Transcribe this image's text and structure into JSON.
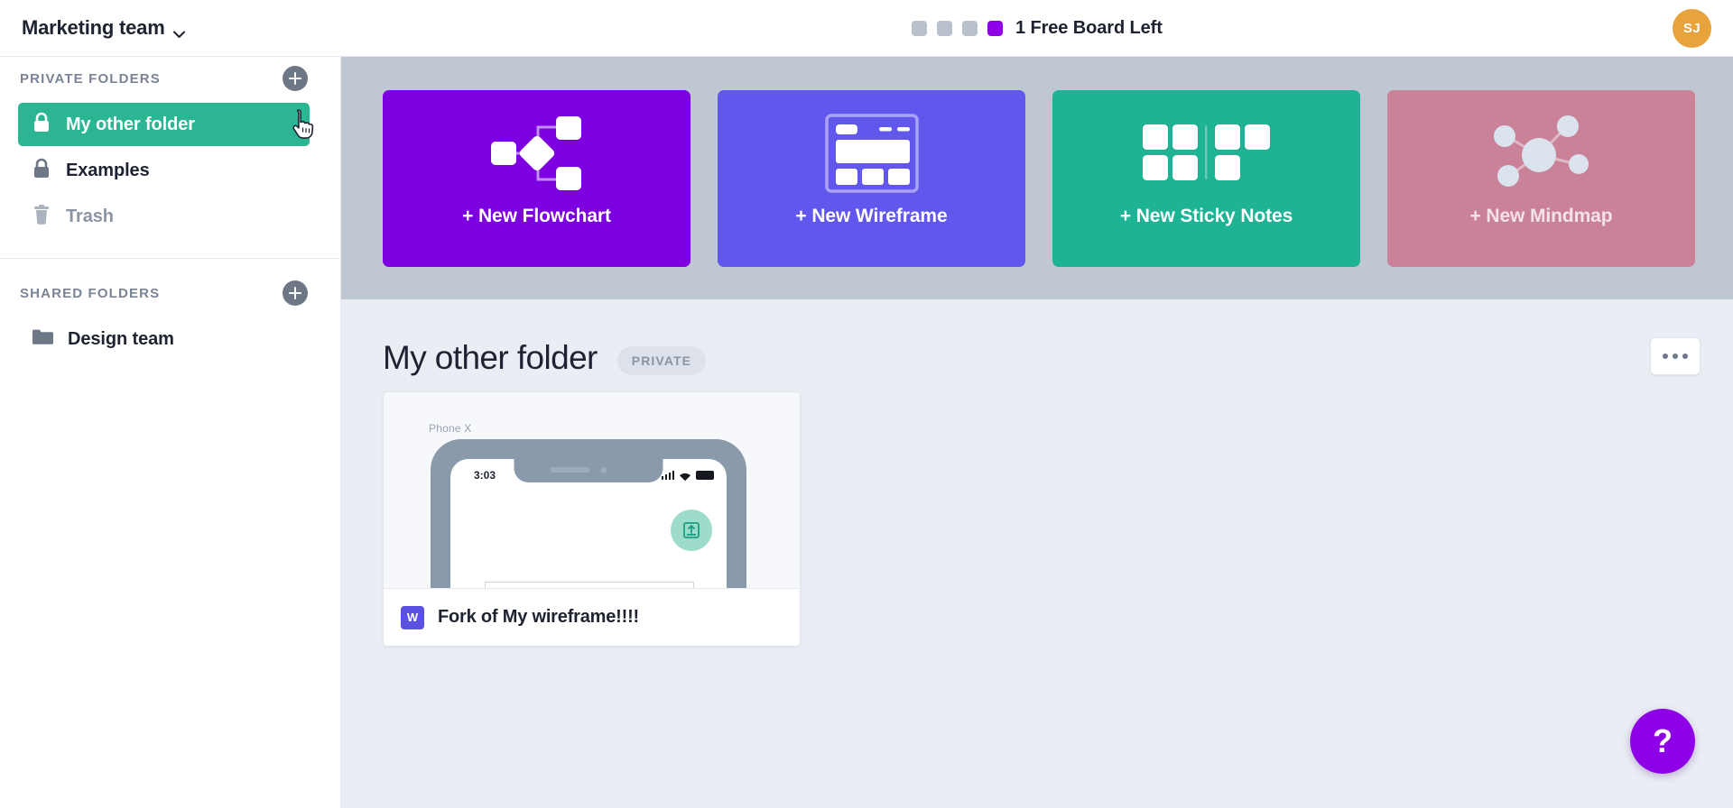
{
  "topbar": {
    "team_name": "Marketing team",
    "team_chevron_icon": "chevron-down-icon",
    "quota_label": "1 Free Board Left",
    "quota_total": 4,
    "quota_used": 1,
    "quota_used_color": "#8e00e6",
    "quota_empty_color": "#b9c1cc",
    "avatar_initials": "SJ",
    "avatar_color": "#e8a33d"
  },
  "sidebar": {
    "private": {
      "title": "PRIVATE FOLDERS",
      "add_icon": "plus-icon",
      "items": [
        {
          "label": "My other folder",
          "icon": "lock-icon",
          "active": true
        },
        {
          "label": "Examples",
          "icon": "lock-icon",
          "active": false
        },
        {
          "label": "Trash",
          "icon": "trash-icon",
          "active": false
        }
      ]
    },
    "shared": {
      "title": "SHARED FOLDERS",
      "add_icon": "plus-icon",
      "items": [
        {
          "label": "Design team",
          "icon": "folder-icon",
          "active": false
        }
      ]
    },
    "active_color": "#2cb593"
  },
  "create_cards": [
    {
      "label": "+ New Flowchart",
      "icon": "flowchart-icon",
      "color": "#7d00e0"
    },
    {
      "label": "+ New Wireframe",
      "icon": "wireframe-icon",
      "color": "#6257ec"
    },
    {
      "label": "+ New Sticky Notes",
      "icon": "sticky-notes-icon",
      "color": "#1db394"
    },
    {
      "label": "+ New Mindmap",
      "icon": "mindmap-icon",
      "color": "#c98298"
    }
  ],
  "folder": {
    "title": "My other folder",
    "badge": "PRIVATE",
    "more_icon": "ellipsis-icon"
  },
  "boards": [
    {
      "name": "Fork of My wireframe!!!!",
      "type_badge": "W",
      "type_badge_color": "#5a50e2",
      "thumb_caption": "Phone X",
      "thumb_time": "3:03",
      "thumb_icons": [
        "signal-icon",
        "wifi-icon",
        "battery-icon"
      ],
      "thumb_fab_icon": "upload-box-icon"
    }
  ],
  "help": {
    "label": "?",
    "color": "#8e00e6"
  },
  "cursor": {
    "icon": "pointing-hand-cursor"
  }
}
